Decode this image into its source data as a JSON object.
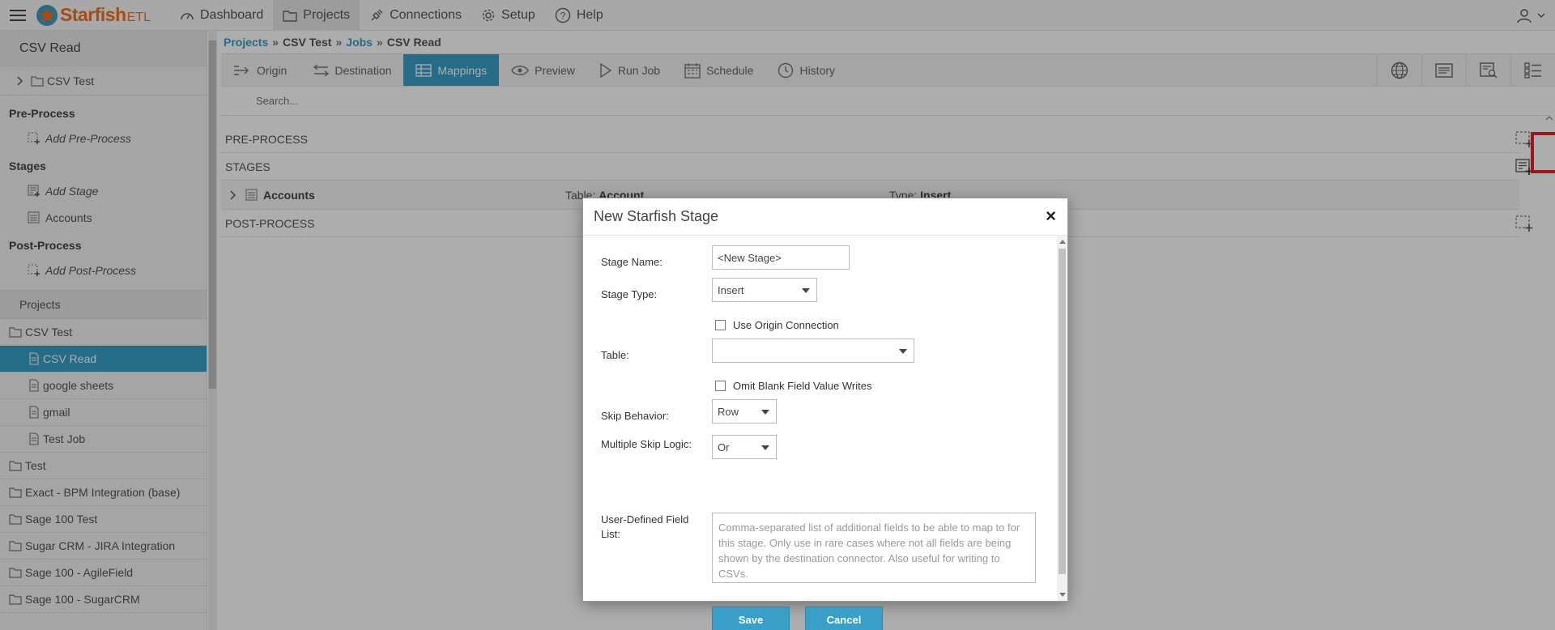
{
  "app": {
    "logo_text": "Starfish",
    "logo_suffix": "ETL"
  },
  "topnav": {
    "items": [
      {
        "label": "Dashboard",
        "icon": "dashboard-icon"
      },
      {
        "label": "Projects",
        "icon": "folder-icon",
        "active": true
      },
      {
        "label": "Connections",
        "icon": "plug-icon"
      },
      {
        "label": "Setup",
        "icon": "gear-icon"
      },
      {
        "label": "Help",
        "icon": "help-icon"
      }
    ]
  },
  "sidebar": {
    "title": "CSV Read",
    "tree_root": "CSV Test",
    "pre_process": {
      "heading": "Pre-Process",
      "add_label": "Add Pre-Process"
    },
    "stages": {
      "heading": "Stages",
      "add_label": "Add Stage",
      "items": [
        "Accounts"
      ]
    },
    "post_process": {
      "heading": "Post-Process",
      "add_label": "Add Post-Process"
    },
    "projects": {
      "heading": "Projects",
      "items": [
        {
          "label": "CSV Test",
          "type": "folder"
        },
        {
          "label": "CSV Read",
          "type": "file",
          "active": true
        },
        {
          "label": "google sheets",
          "type": "file"
        },
        {
          "label": "gmail",
          "type": "file"
        },
        {
          "label": "Test Job",
          "type": "file"
        },
        {
          "label": "Test",
          "type": "folder"
        },
        {
          "label": "Exact - BPM Integration (base)",
          "type": "folder"
        },
        {
          "label": "Sage 100 Test",
          "type": "folder"
        },
        {
          "label": "Sugar CRM - JIRA Integration",
          "type": "folder"
        },
        {
          "label": "Sage 100 - AgileField",
          "type": "folder"
        },
        {
          "label": "Sage 100 - SugarCRM",
          "type": "folder"
        }
      ]
    }
  },
  "breadcrumb": {
    "projects": "Projects",
    "sep": "»",
    "project": "CSV Test",
    "jobs": "Jobs",
    "current": "CSV Read"
  },
  "toolbar": {
    "tabs": [
      {
        "label": "Origin",
        "icon": "origin-icon"
      },
      {
        "label": "Destination",
        "icon": "destination-icon"
      },
      {
        "label": "Mappings",
        "icon": "grid-icon",
        "active": true
      },
      {
        "label": "Preview",
        "icon": "eye-icon"
      },
      {
        "label": "Run Job",
        "icon": "play-icon"
      },
      {
        "label": "Schedule",
        "icon": "calendar-icon"
      },
      {
        "label": "History",
        "icon": "history-icon"
      }
    ],
    "right_icons": [
      "globe-icon",
      "list-view-icon",
      "search-doc-icon",
      "list-detail-icon"
    ]
  },
  "search": {
    "placeholder": "Search..."
  },
  "mappings": {
    "pre_process_label": "PRE-PROCESS",
    "stages_label": "STAGES",
    "post_process_label": "POST-PROCESS",
    "stage_rows": [
      {
        "name": "Accounts",
        "table_label": "Table:",
        "table": "Account",
        "type_label": "Type:",
        "type": "Insert"
      }
    ]
  },
  "modal": {
    "title": "New Starfish Stage",
    "close": "×",
    "stage_name_label": "Stage Name:",
    "stage_name_value": "<New Stage>",
    "stage_type_label": "Stage Type:",
    "stage_type_value": "Insert",
    "use_origin_label": "Use Origin Connection",
    "use_origin_checked": false,
    "table_label": "Table:",
    "table_value": "",
    "omit_blank_label": "Omit Blank Field Value Writes",
    "omit_blank_checked": false,
    "skip_behavior_label": "Skip Behavior:",
    "skip_behavior_value": "Row",
    "multi_skip_label": "Multiple Skip Logic:",
    "multi_skip_value": "Or",
    "udf_label": "User-Defined Field List:",
    "udf_placeholder": "Comma-separated list of additional fields to be able to map to for this stage. Only use in rare cases where not all fields are being shown by the destination connector. Also useful for writing to CSVs.",
    "save_label": "Save",
    "cancel_label": "Cancel"
  },
  "colors": {
    "accent": "#3a9fc6",
    "brand": "#f37021",
    "highlight": "#e32229"
  }
}
